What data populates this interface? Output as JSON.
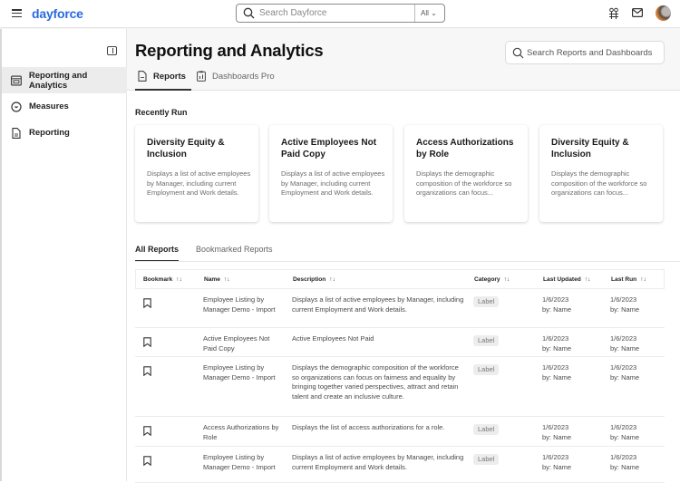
{
  "topbar": {
    "logo": "dayforce",
    "search_placeholder": "Search Dayforce",
    "search_scope": "All",
    "icons": [
      "menu-icon",
      "people-icon",
      "mail-icon",
      "user-avatar"
    ]
  },
  "sidebar": {
    "items": [
      {
        "label": "Reporting and Analytics",
        "icon": "report-dashboard-icon",
        "active": true
      },
      {
        "label": "Measures",
        "icon": "measures-icon",
        "active": false
      },
      {
        "label": "Reporting",
        "icon": "document-icon",
        "active": false
      }
    ]
  },
  "header": {
    "title": "Reporting and Analytics",
    "search_placeholder": "Search Reports and Dashboards",
    "tabs": [
      {
        "label": "Reports",
        "active": true
      },
      {
        "label": "Dashboards Pro",
        "active": false
      }
    ]
  },
  "recent": {
    "title": "Recently Run",
    "cards": [
      {
        "title": "Diversity Equity & Inclusion",
        "desc": "Displays a list of active employees by Manager, including current Employment and Work details."
      },
      {
        "title": "Active Employees Not Paid Copy",
        "desc": "Displays a list of active employees by Manager, including current Employment and Work details."
      },
      {
        "title": "Access Authorizations by Role",
        "desc": "Displays the demographic composition of the workforce so organizations can focus..."
      },
      {
        "title": "Diversity Equity & Inclusion",
        "desc": "Displays the demographic composition of the workforce so organizations can focus..."
      }
    ]
  },
  "list_tabs": [
    {
      "label": "All Reports",
      "active": true
    },
    {
      "label": "Bookmarked Reports",
      "active": false
    }
  ],
  "table": {
    "sort_glyph": "↑↓",
    "columns": [
      "Bookmark",
      "Name",
      "Description",
      "Category",
      "Last Updated",
      "Last Run"
    ],
    "rows": [
      {
        "name": "Employee Listing by Manager Demo - Import",
        "description": "Displays a list of active employees by Manager, including current Employment and Work details.",
        "category": "Label",
        "updated_date": "1/6/2023",
        "updated_by": "by: Name",
        "run_date": "1/6/2023",
        "run_by": "by: Name"
      },
      {
        "name": "Active Employees Not Paid Copy",
        "description": "Active Employees Not Paid",
        "category": "Label",
        "updated_date": "1/6/2023",
        "updated_by": "by: Name",
        "run_date": "1/6/2023",
        "run_by": "by: Name"
      },
      {
        "name": "Employee Listing by Manager Demo - Import",
        "description": "Displays the demographic composition of the workforce so organizations can focus on fairness and equality by bringing together varied perspectives, attract and retain talent and create an inclusive culture.",
        "category": "Label",
        "updated_date": "1/6/2023",
        "updated_by": "by: Name",
        "run_date": "1/6/2023",
        "run_by": "by: Name"
      },
      {
        "name": "Access Authorizations by Role",
        "description": "Displays the list of access authorizations for a role.",
        "category": "Label",
        "updated_date": "1/6/2023",
        "updated_by": "by: Name",
        "run_date": "1/6/2023",
        "run_by": "by: Name"
      },
      {
        "name": "Employee Listing by Manager Demo - Import",
        "description": "Displays a list of active employees by Manager, including current Employment and Work details.",
        "category": "Label",
        "updated_date": "1/6/2023",
        "updated_by": "by: Name",
        "run_date": "1/6/2023",
        "run_by": "by: Name"
      }
    ]
  },
  "colors": {
    "brand": "#2a6ae0",
    "active_nav_bg": "#ececec",
    "label_bg": "#ededed"
  }
}
